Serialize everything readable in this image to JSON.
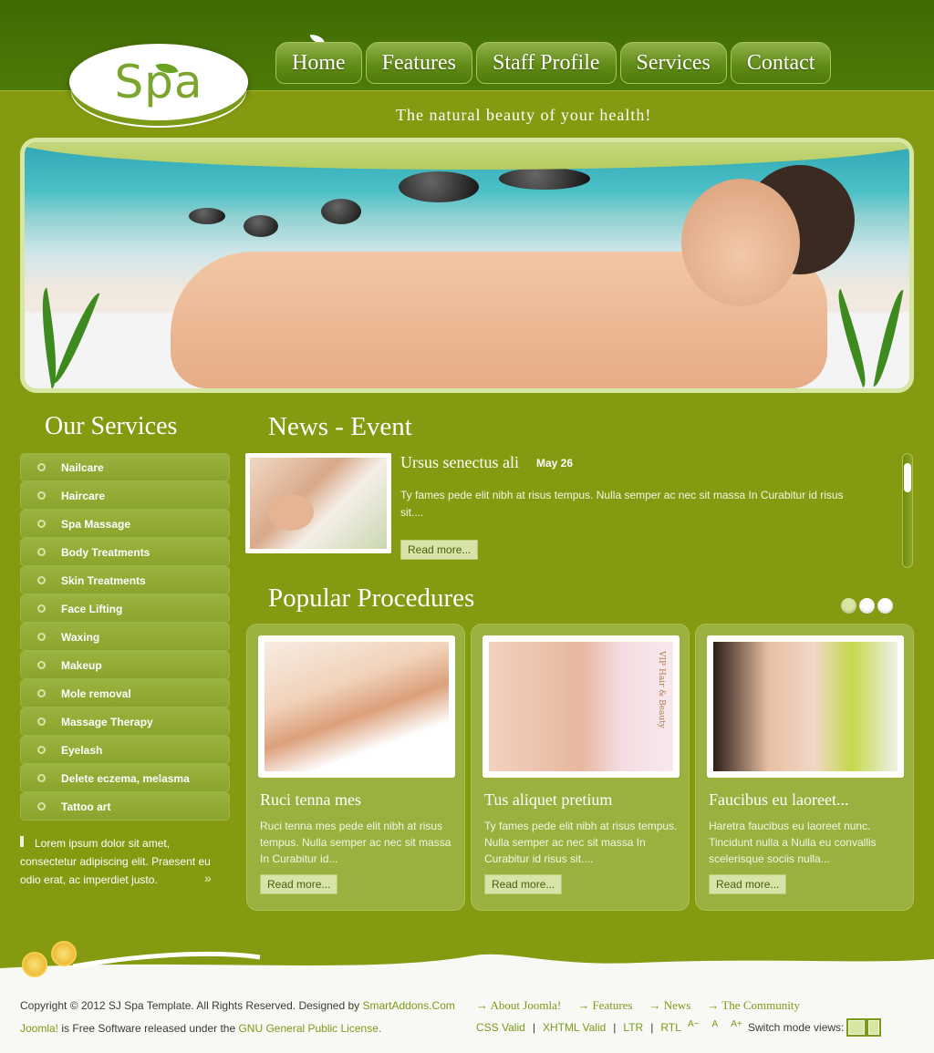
{
  "logo": {
    "text": "Spa"
  },
  "nav": {
    "items": [
      "Home",
      "Features",
      "Staff Profile",
      "Services",
      "Contact"
    ]
  },
  "tagline": "The natural beauty of your health!",
  "services": {
    "title": "Our Services",
    "items": [
      "Nailcare",
      "Haircare",
      "Spa Massage",
      "Body Treatments",
      "Skin Treatments",
      "Face Lifting",
      "Waxing",
      "Makeup",
      "Mole removal",
      "Massage Therapy",
      "Eyelash",
      "Delete eczema, melasma",
      "Tattoo art"
    ],
    "quote": "Lorem ipsum dolor sit amet, consectetur adipiscing elit. Praesent eu odio erat, ac imperdiet justo."
  },
  "news": {
    "title": "News - Event",
    "headline": "Ursus senectus ali",
    "date": "May 26",
    "text": "Ty fames pede elit nibh at risus tempus. Nulla semper ac nec sit massa In Curabitur id risus sit....",
    "read_more": "Read more..."
  },
  "popular": {
    "title": "Popular Procedures",
    "cards": [
      {
        "title": "Ruci tenna mes",
        "text": "Ruci tenna mes pede elit nibh at risus tempus. Nulla semper ac nec sit massa In Curabitur id...",
        "read_more": "Read more..."
      },
      {
        "title": "Tus aliquet pretium",
        "text": "Ty fames pede elit nibh at risus tempus. Nulla semper ac nec sit massa In Curabitur id risus sit....",
        "read_more": "Read more...",
        "image_caption": "VIP Hair & Beauty"
      },
      {
        "title": "Faucibus eu laoreet...",
        "text": "Haretra faucibus eu laoreet nunc. Tincidunt nulla a Nulla eu convallis scelerisque sociis nulla...",
        "read_more": "Read more..."
      }
    ]
  },
  "footer": {
    "copyright_prefix": "Copyright © 2012 SJ Spa Template. All Rights Reserved. Designed by ",
    "designer": "SmartAddons.Com",
    "license_joomla": "Joomla!",
    "license_middle": " is Free Software released under the ",
    "license_gnu": "GNU General Public License.",
    "links": [
      "About Joomla!",
      "Features",
      "News",
      "The Community"
    ],
    "validators": [
      "CSS Valid",
      "XHTML Valid",
      "LTR",
      "RTL"
    ],
    "font_sizer": [
      "A−",
      "A",
      "A+"
    ],
    "switch_label": "Switch mode views:"
  },
  "colors": {
    "header": "#4e7a08",
    "body": "#859a10",
    "accent": "#7a9a18"
  }
}
